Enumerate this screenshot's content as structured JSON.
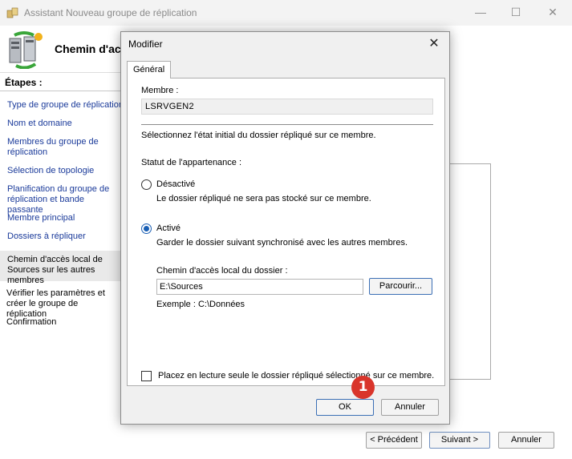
{
  "wizard": {
    "title": "Assistant Nouveau groupe de réplication",
    "header_title": "Chemin d'ac",
    "steps_title": "Étapes :",
    "steps": [
      {
        "label": "Type de groupe de réplication",
        "state": "link"
      },
      {
        "label": "Nom et domaine",
        "state": "link"
      },
      {
        "label": "Membres du groupe de réplication",
        "state": "link"
      },
      {
        "label": "Sélection de topologie",
        "state": "link"
      },
      {
        "label": "Planification du groupe de réplication et bande passante",
        "state": "link"
      },
      {
        "label": "Membre principal",
        "state": "link"
      },
      {
        "label": "Dossiers à répliquer",
        "state": "link"
      },
      {
        "label": "Chemin d'accès local de Sources sur les autres membres",
        "state": "current"
      },
      {
        "label": "Vérifier les paramètres et créer le groupe de réplication",
        "state": "plain"
      },
      {
        "label": "Confirmation",
        "state": "plain"
      }
    ],
    "buttons": {
      "previous": "< Précédent",
      "next": "Suivant >",
      "cancel": "Annuler"
    },
    "window_controls": {
      "minimize": "—",
      "maximize": "☐",
      "close": "✕"
    }
  },
  "dialog": {
    "title": "Modifier",
    "close_glyph": "✕",
    "tab_label": "Général",
    "member_label": "Membre :",
    "member_value": "LSRVGEN2",
    "instruction": "Sélectionnez l'état initial du dossier répliqué sur ce membre.",
    "membership_label": "Statut de l'appartenance :",
    "options": [
      {
        "label": "Désactivé",
        "description": "Le dossier répliqué ne sera pas stocké sur ce membre.",
        "selected": false
      },
      {
        "label": "Activé",
        "description": "Garder le dossier suivant synchronisé avec les autres membres.",
        "selected": true
      }
    ],
    "path_label": "Chemin d'accès local du dossier :",
    "path_value": "E:\\Sources",
    "browse_label": "Parcourir...",
    "example_text": "Exemple : C:\\Données",
    "readonly_label": "Placez en lecture seule le dossier répliqué sélectionné sur ce membre.",
    "readonly_checked": false,
    "ok_label": "OK",
    "cancel_label": "Annuler"
  },
  "annotation": {
    "number": "1",
    "color": "#d9352b"
  },
  "colors": {
    "link": "#1a3a9a",
    "accent": "#1a5fb4",
    "dialog_bg": "#f0f0f0"
  }
}
